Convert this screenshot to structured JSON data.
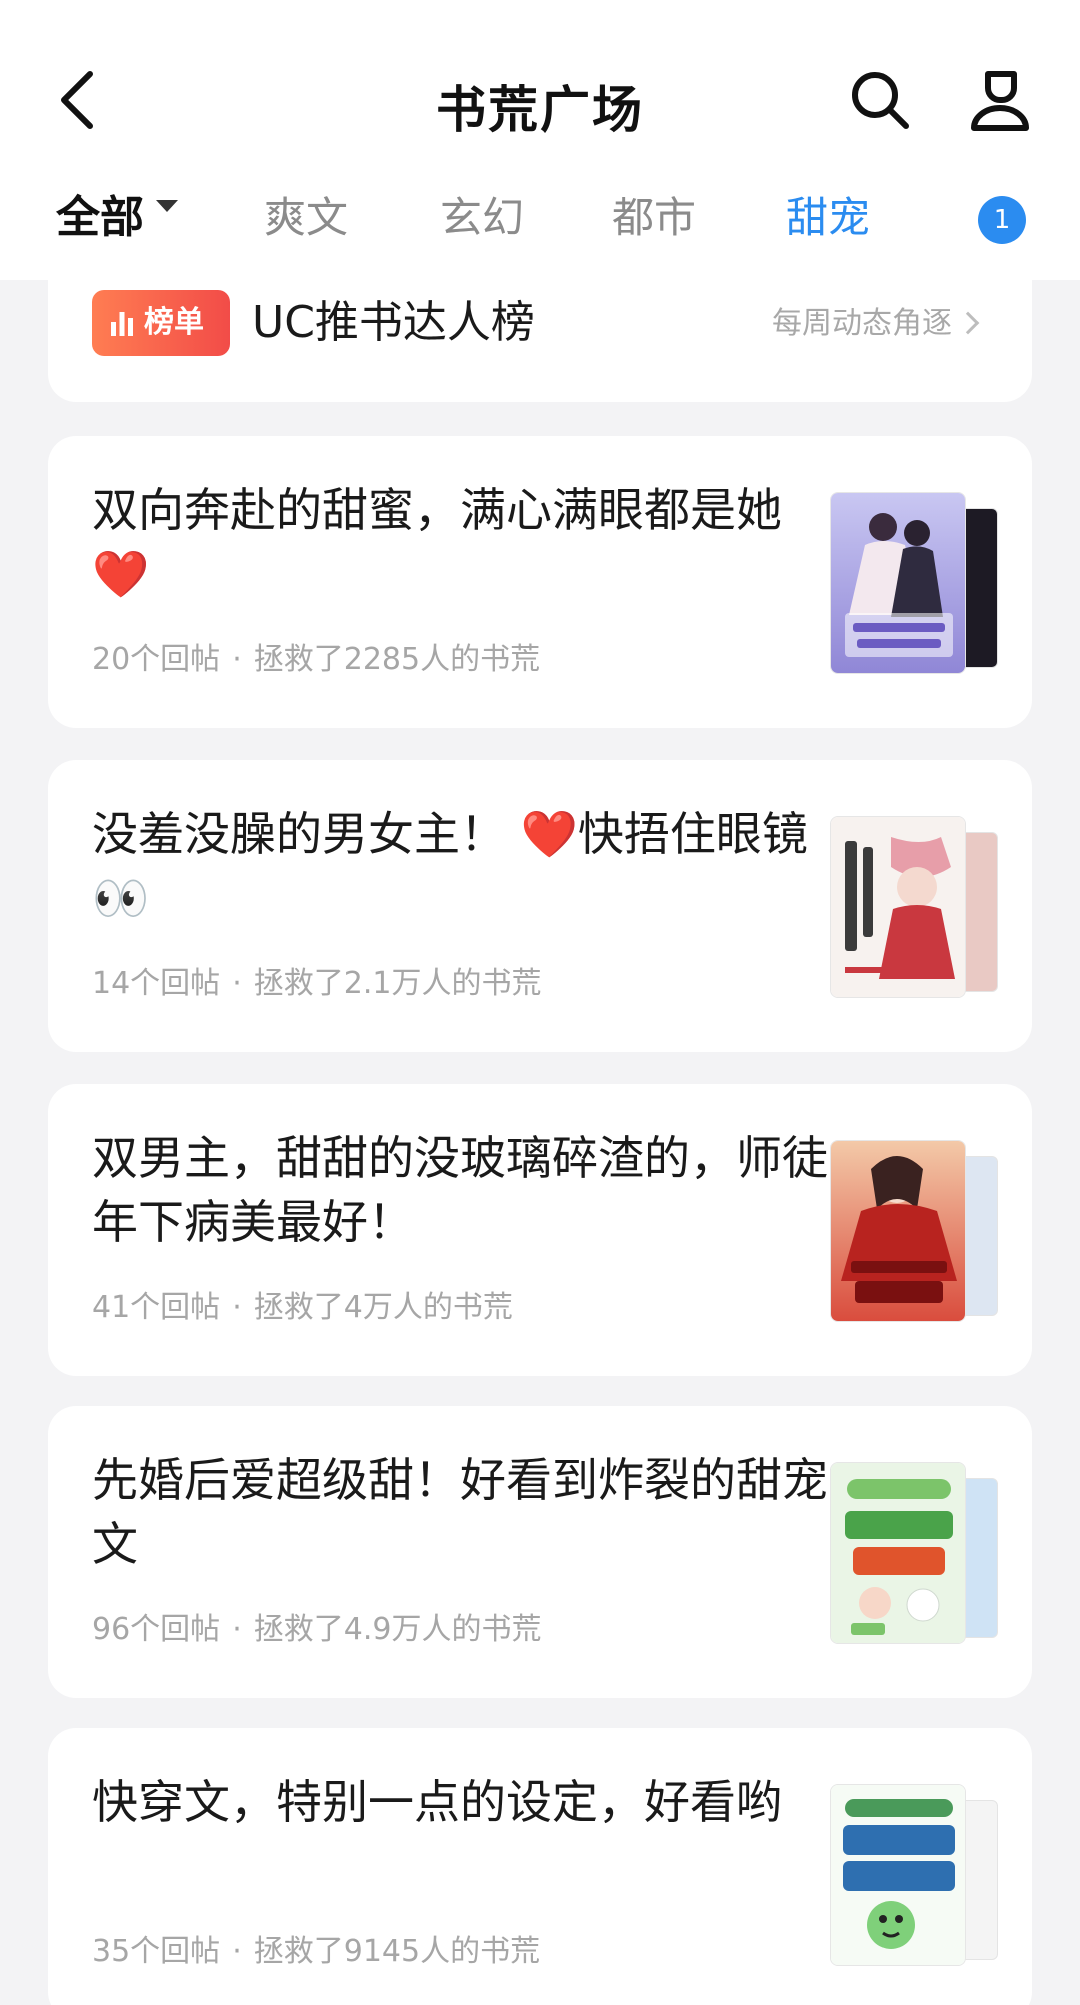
{
  "header": {
    "title": "书荒广场",
    "tabs": [
      {
        "label": "全部",
        "active": true
      },
      {
        "label": "爽文"
      },
      {
        "label": "玄幻"
      },
      {
        "label": "都市"
      },
      {
        "label": "甜宠",
        "highlighted": true
      }
    ],
    "badge": "1",
    "icons": {
      "back": "back-arrow-icon",
      "search": "search-icon",
      "user": "user-icon"
    }
  },
  "ranking": {
    "tag": "榜单",
    "title": "UC推书达人榜",
    "subtitle": "每周动态角逐"
  },
  "posts": [
    {
      "title": "双向奔赴的甜蜜，满心满眼都是她❤️",
      "replies": "20个回帖",
      "saved": "拯救了2285人的书荒"
    },
    {
      "title": "没羞没臊的男女主！ ❤️快捂住眼镜👀",
      "replies": "14个回帖",
      "saved": "拯救了2.1万人的书荒"
    },
    {
      "title": "双男主，甜甜的没玻璃碎渣的，师徒年下病美最好！",
      "replies": "41个回帖",
      "saved": "拯救了4万人的书荒"
    },
    {
      "title": "先婚后爱超级甜！好看到炸裂的甜宠文",
      "replies": "96个回帖",
      "saved": "拯救了4.9万人的书荒"
    },
    {
      "title": "快穿文，特别一点的设定，好看哟",
      "replies": "35个回帖",
      "saved": "拯救了9145人的书荒"
    }
  ],
  "colors": {
    "accent": "#2b8cf0",
    "tag_start": "#ff7d52",
    "tag_end": "#f24c48",
    "background": "#f3f3f5"
  }
}
